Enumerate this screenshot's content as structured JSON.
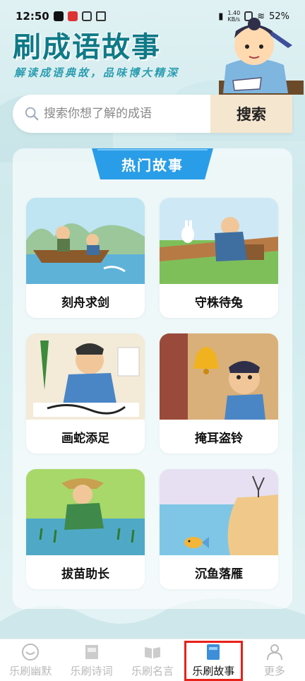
{
  "status_bar": {
    "time": "12:50",
    "net_speed_value": "1.40",
    "net_speed_unit": "KB/s",
    "battery": "52%"
  },
  "header": {
    "title": "刷成语故事",
    "subtitle": "解读成语典故，品味博大精深"
  },
  "search": {
    "placeholder": "搜索你想了解的成语",
    "button_label": "搜索"
  },
  "section": {
    "title": "热门故事"
  },
  "stories": [
    {
      "title": "刻舟求剑",
      "icon": "boat-scene"
    },
    {
      "title": "守株待兔",
      "icon": "rabbit-scene"
    },
    {
      "title": "画蛇添足",
      "icon": "painting-scene"
    },
    {
      "title": "掩耳盗铃",
      "icon": "bell-scene"
    },
    {
      "title": "拔苗助长",
      "icon": "seedling-scene"
    },
    {
      "title": "沉鱼落雁",
      "icon": "fish-goose-scene"
    }
  ],
  "bottom_nav": {
    "items": [
      {
        "label": "乐刷幽默",
        "icon": "smile-icon",
        "active": false
      },
      {
        "label": "乐刷诗词",
        "icon": "poem-book-icon",
        "active": false
      },
      {
        "label": "乐刷名言",
        "icon": "open-book-icon",
        "active": false
      },
      {
        "label": "乐刷故事",
        "icon": "story-book-icon",
        "active": true
      },
      {
        "label": "更多",
        "icon": "person-icon",
        "active": false
      }
    ]
  },
  "colors": {
    "title": "#0f7a87",
    "accent_blue": "#2a9de8",
    "active_outline": "#e8211a",
    "search_button_bg": "#f4e6cf"
  }
}
